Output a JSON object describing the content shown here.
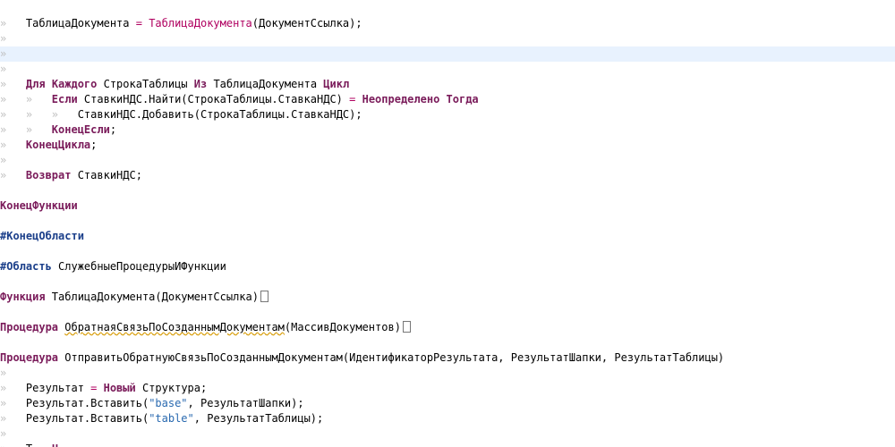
{
  "editor": {
    "lines": [
      {
        "tokens": [
          {
            "t": "ws",
            "v": "»   "
          },
          {
            "t": "id",
            "v": "ТаблицаДокумента "
          },
          {
            "t": "op",
            "v": "= "
          },
          {
            "t": "idfunc",
            "v": "ТаблицаДокумента"
          },
          {
            "t": "id",
            "v": "(ДокументСсылка);"
          }
        ]
      },
      {
        "tokens": [
          {
            "t": "ws",
            "v": "»"
          }
        ]
      },
      {
        "current": true,
        "tokens": [
          {
            "t": "ws",
            "v": "»"
          }
        ]
      },
      {
        "tokens": [
          {
            "t": "ws",
            "v": "»"
          }
        ]
      },
      {
        "tokens": [
          {
            "t": "ws",
            "v": "»   "
          },
          {
            "t": "kw",
            "v": "Для "
          },
          {
            "t": "kw",
            "v": "Каждого "
          },
          {
            "t": "id",
            "v": "СтрокаТаблицы "
          },
          {
            "t": "kw",
            "v": "Из "
          },
          {
            "t": "id",
            "v": "ТаблицаДокумента "
          },
          {
            "t": "kw",
            "v": "Цикл"
          }
        ]
      },
      {
        "tokens": [
          {
            "t": "ws",
            "v": "»   »   "
          },
          {
            "t": "kw",
            "v": "Если "
          },
          {
            "t": "id",
            "v": "СтавкиНДС.Найти(СтрокаТаблицы.СтавкаНДС) "
          },
          {
            "t": "op",
            "v": "= "
          },
          {
            "t": "kw",
            "v": "Неопределено "
          },
          {
            "t": "kw",
            "v": "Тогда"
          }
        ]
      },
      {
        "tokens": [
          {
            "t": "ws",
            "v": "»   »   »   "
          },
          {
            "t": "id",
            "v": "СтавкиНДС.Добавить(СтрокаТаблицы.СтавкаНДС);"
          }
        ]
      },
      {
        "tokens": [
          {
            "t": "ws",
            "v": "»   »   "
          },
          {
            "t": "kw",
            "v": "КонецЕсли"
          },
          {
            "t": "id",
            "v": ";"
          }
        ]
      },
      {
        "tokens": [
          {
            "t": "ws",
            "v": "»   "
          },
          {
            "t": "kw",
            "v": "КонецЦикла"
          },
          {
            "t": "id",
            "v": ";"
          }
        ]
      },
      {
        "tokens": [
          {
            "t": "ws",
            "v": "»"
          }
        ]
      },
      {
        "tokens": [
          {
            "t": "ws",
            "v": "»   "
          },
          {
            "t": "kw",
            "v": "Возврат "
          },
          {
            "t": "id",
            "v": "СтавкиНДС;"
          }
        ]
      },
      {
        "tokens": []
      },
      {
        "tokens": [
          {
            "t": "kw",
            "v": "КонецФункции"
          }
        ]
      },
      {
        "tokens": []
      },
      {
        "tokens": [
          {
            "t": "pre",
            "v": "#КонецОбласти"
          }
        ]
      },
      {
        "tokens": []
      },
      {
        "tokens": [
          {
            "t": "pre",
            "v": "#Область "
          },
          {
            "t": "id",
            "v": "СлужебныеПроцедурыИФункции"
          }
        ]
      },
      {
        "tokens": []
      },
      {
        "tokens": [
          {
            "t": "kw",
            "v": "Функция "
          },
          {
            "t": "id",
            "v": "ТаблицаДокумента(ДокументСсылка)"
          }
        ],
        "collapsed": true
      },
      {
        "tokens": []
      },
      {
        "tokens": [
          {
            "t": "kw",
            "v": "Процедура "
          },
          {
            "t": "id",
            "v": "ОбратнаяСвязьПоСозданнымДокументам",
            "u": true
          },
          {
            "t": "id",
            "v": "(МассивДокументов)"
          }
        ],
        "collapsed": true
      },
      {
        "tokens": []
      },
      {
        "tokens": [
          {
            "t": "kw",
            "v": "Процедура "
          },
          {
            "t": "id",
            "v": "ОтправитьОбратнуюСвязьПоСозданнымДокументам(ИдентификаторРезультата, РезультатШапки, РезультатТаблицы)"
          }
        ]
      },
      {
        "tokens": [
          {
            "t": "ws",
            "v": "»"
          }
        ]
      },
      {
        "tokens": [
          {
            "t": "ws",
            "v": "»   "
          },
          {
            "t": "id",
            "v": "Результат "
          },
          {
            "t": "op",
            "v": "= "
          },
          {
            "t": "kw",
            "v": "Новый "
          },
          {
            "t": "id",
            "v": "Структура;"
          }
        ]
      },
      {
        "tokens": [
          {
            "t": "ws",
            "v": "»   "
          },
          {
            "t": "id",
            "v": "Результат.Вставить("
          },
          {
            "t": "str",
            "v": "\"base\""
          },
          {
            "t": "id",
            "v": ", РезультатШапки);"
          }
        ]
      },
      {
        "tokens": [
          {
            "t": "ws",
            "v": "»   "
          },
          {
            "t": "id",
            "v": "Результат.Вставить("
          },
          {
            "t": "str",
            "v": "\"table\""
          },
          {
            "t": "id",
            "v": ", РезультатТаблицы);"
          }
        ]
      },
      {
        "tokens": [
          {
            "t": "ws",
            "v": "»"
          }
        ]
      },
      {
        "tokens": [
          {
            "t": "ws",
            "v": "»   "
          },
          {
            "t": "id",
            "v": "Т"
          },
          {
            "t": "ws",
            "v": "   "
          },
          {
            "t": "kw",
            "v": "Н"
          }
        ]
      }
    ]
  },
  "colors": {
    "keyword": "#7a1b5a",
    "preprocessor": "#1b3f8a",
    "string": "#2a6ab0",
    "operator": "#b00060",
    "current_line": "#e8f2fe"
  }
}
